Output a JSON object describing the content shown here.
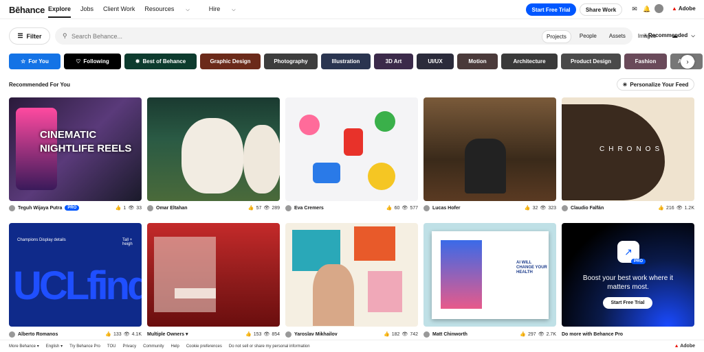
{
  "header": {
    "logo": "Bēhance",
    "nav": [
      "Explore",
      "Jobs",
      "Client Work",
      "Resources",
      "Hire"
    ],
    "trial_button": "Start Free Trial",
    "share_button": "Share Work",
    "adobe": "Adobe"
  },
  "search": {
    "filter_label": "Filter",
    "placeholder": "Search Behance...",
    "tabs": [
      "Projects",
      "People",
      "Assets",
      "Images"
    ],
    "selected_tab": "Projects",
    "sort": "Recommended"
  },
  "categories": [
    {
      "label": "For You",
      "color": "#1473e6"
    },
    {
      "label": "Following",
      "color": "#000000"
    },
    {
      "label": "Best of Behance",
      "color": "#0d3b2e"
    },
    {
      "label": "Graphic Design",
      "color": "#6b2a1a"
    },
    {
      "label": "Photography",
      "color": "#3d3d3d"
    },
    {
      "label": "Illustration",
      "color": "#2a3550"
    },
    {
      "label": "3D Art",
      "color": "#3b2a4a"
    },
    {
      "label": "UI/UX",
      "color": "#2b2b3b"
    },
    {
      "label": "Motion",
      "color": "#4a3a3a"
    },
    {
      "label": "Architecture",
      "color": "#3a3a3a"
    },
    {
      "label": "Product Design",
      "color": "#4a4a4a"
    },
    {
      "label": "Fashion",
      "color": "#6a4a5a"
    },
    {
      "label": "Adobe",
      "color": "#777777"
    }
  ],
  "section_title": "Recommended For You",
  "personalize_button": "Personalize Your Feed",
  "projects": [
    {
      "owner": "Teguh Wijaya Putra",
      "pro": "PRO",
      "likes": "1",
      "views": "33",
      "art_text": "CINEMATIC NIGHTLIFE REELS"
    },
    {
      "owner": "Omar Eltahan",
      "likes": "57",
      "views": "289"
    },
    {
      "owner": "Eva Cremers",
      "likes": "60",
      "views": "577"
    },
    {
      "owner": "Lucas Hofer",
      "likes": "32",
      "views": "323"
    },
    {
      "owner": "Claudio Falfán",
      "likes": "216",
      "views": "1.2K",
      "art_text": "CHRONOS"
    },
    {
      "owner": "Alberto Romanos",
      "likes": "133",
      "views": "4.1K",
      "art_text": "UCLfind",
      "art_caption": "Champions Display details",
      "art_caption2": "Tall + heigh"
    },
    {
      "owner": "Multiple Owners",
      "likes": "153",
      "views": "854"
    },
    {
      "owner": "Yaroslav Mikhailov",
      "likes": "182",
      "views": "742"
    },
    {
      "owner": "Matt Chinworth",
      "likes": "297",
      "views": "2.7K",
      "art_text": "AI WILL CHANGE YOUR HEALTH"
    },
    {
      "owner": "Do more with Behance Pro",
      "promo_title": "Boost your best work where it matters most.",
      "promo_button": "Start Free Trial",
      "promo_badge": "PRO"
    }
  ],
  "footer": [
    "More Behance",
    "English",
    "Try Behance Pro",
    "TOU",
    "Privacy",
    "Community",
    "Help",
    "Cookie preferences",
    "Do not sell or share my personal information"
  ],
  "footer_adobe": "Adobe"
}
